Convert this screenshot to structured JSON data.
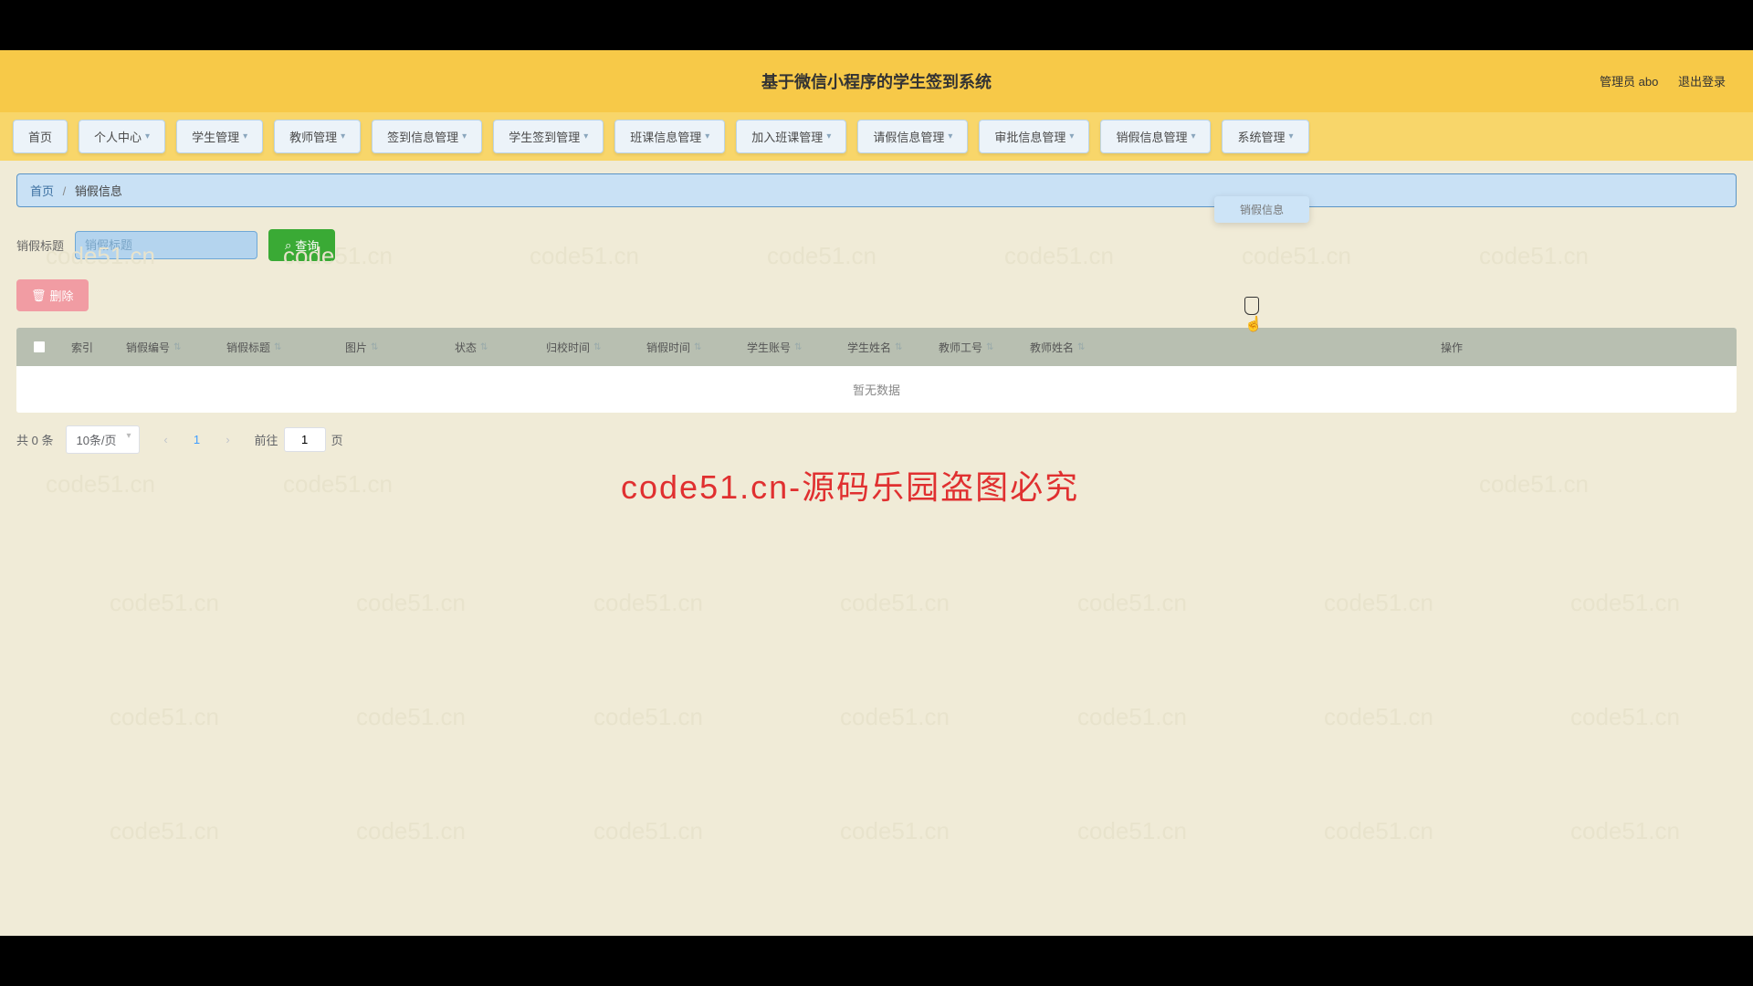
{
  "header": {
    "title": "基于微信小程序的学生签到系统",
    "role_label": "管理员 abo",
    "logout": "退出登录"
  },
  "nav": [
    {
      "label": "首页",
      "has_caret": false
    },
    {
      "label": "个人中心",
      "has_caret": true
    },
    {
      "label": "学生管理",
      "has_caret": true
    },
    {
      "label": "教师管理",
      "has_caret": true
    },
    {
      "label": "签到信息管理",
      "has_caret": true
    },
    {
      "label": "学生签到管理",
      "has_caret": true
    },
    {
      "label": "班课信息管理",
      "has_caret": true
    },
    {
      "label": "加入班课管理",
      "has_caret": true
    },
    {
      "label": "请假信息管理",
      "has_caret": true
    },
    {
      "label": "审批信息管理",
      "has_caret": true
    },
    {
      "label": "销假信息管理",
      "has_caret": true
    },
    {
      "label": "系统管理",
      "has_caret": true
    }
  ],
  "nav_dropdown": {
    "label": "销假信息"
  },
  "breadcrumb": {
    "home": "首页",
    "current": "销假信息"
  },
  "filter": {
    "label": "销假标题",
    "placeholder": "销假标题",
    "search_btn": "查询"
  },
  "actions": {
    "delete_btn": "删除"
  },
  "table": {
    "columns": {
      "index": "索引",
      "id": "销假编号",
      "title": "销假标题",
      "img": "图片",
      "status": "状态",
      "back_time": "归校时间",
      "x_time": "销假时间",
      "account": "学生账号",
      "sname": "学生姓名",
      "tid": "教师工号",
      "tname": "教师姓名",
      "ops": "操作"
    },
    "empty": "暂无数据"
  },
  "pagination": {
    "total_label": "共 0 条",
    "page_size": "10条/页",
    "current": "1",
    "jump_prefix": "前往",
    "jump_value": "1",
    "jump_suffix": "页"
  },
  "watermark_text": "code51.cn",
  "watermark_red": "code51.cn-源码乐园盗图必究"
}
